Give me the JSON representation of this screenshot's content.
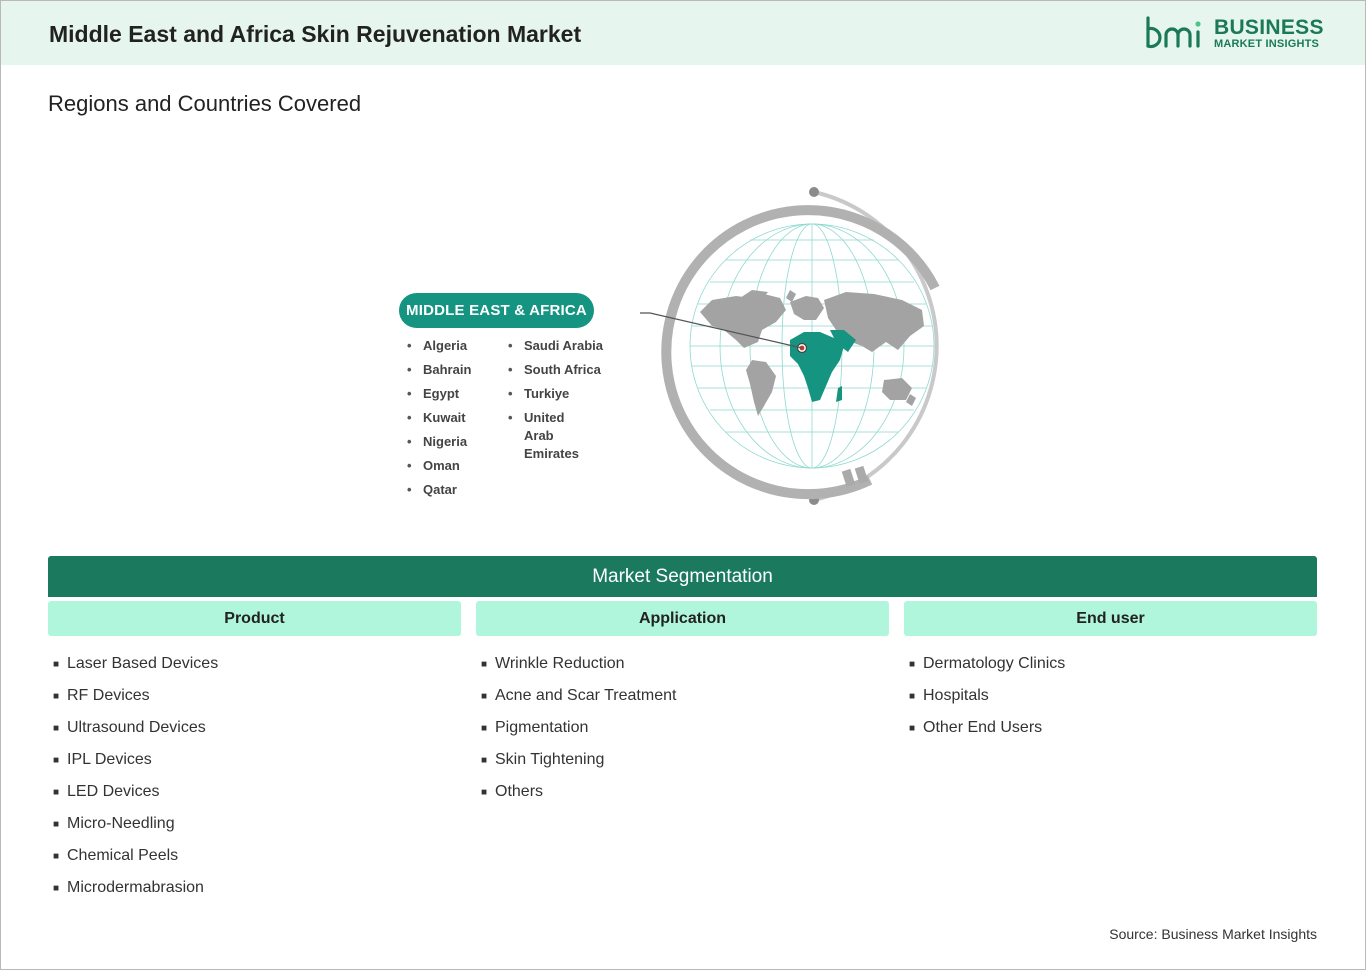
{
  "header": {
    "title": "Middle East and Africa Skin Rejuvenation Market",
    "logo": {
      "line1": "BUSINESS",
      "line2": "MARKET INSIGHTS",
      "mark_text": "bmi"
    }
  },
  "regions": {
    "subtitle": "Regions and Countries Covered",
    "region_label": "MIDDLE EAST & AFRICA",
    "countries_col1": [
      "Algeria",
      "Bahrain",
      "Egypt",
      "Kuwait",
      "Nigeria",
      "Oman",
      "Qatar"
    ],
    "countries_col2": [
      "Saudi Arabia",
      "South Africa",
      "Turkiye",
      "United Arab Emirates"
    ]
  },
  "segmentation": {
    "title": "Market Segmentation",
    "columns": [
      {
        "heading": "Product",
        "items": [
          "Laser Based Devices",
          "RF Devices",
          "Ultrasound Devices",
          "IPL Devices",
          "LED Devices",
          "Micro-Needling",
          "Chemical Peels",
          "Microdermabrasion"
        ]
      },
      {
        "heading": "Application",
        "items": [
          "Wrinkle Reduction",
          "Acne and Scar Treatment",
          "Pigmentation",
          "Skin Tightening",
          "Others"
        ]
      },
      {
        "heading": "End user",
        "items": [
          "Dermatology Clinics",
          "Hospitals",
          "Other End Users"
        ]
      }
    ]
  },
  "source": "Source: Business Market Insights",
  "colors": {
    "brand": "#1b7a55",
    "accent": "#169482",
    "header_bg": "#e6f6ef",
    "seg_head_bg": "#b0f6dd",
    "seg_bar": "#1b7a5e"
  }
}
